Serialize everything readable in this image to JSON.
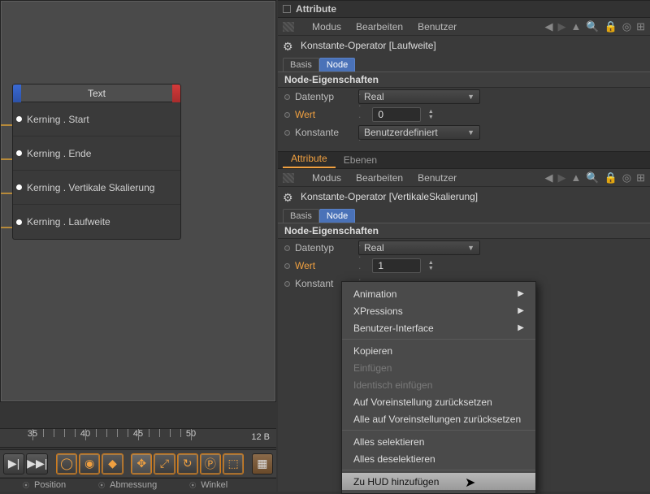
{
  "node": {
    "title": "Text",
    "rows": [
      {
        "label": "Kerning . Start",
        "connected": true
      },
      {
        "label": "Kerning . Ende",
        "connected": true
      },
      {
        "label": "Kerning . Vertikale Skalierung",
        "connected": true
      },
      {
        "label": "Kerning . Laufweite",
        "connected": true
      }
    ]
  },
  "ruler": {
    "ticks": [
      "35",
      "40",
      "45",
      "50"
    ],
    "right": "12 B"
  },
  "status": {
    "pos": "Position",
    "dim": "Abmessung",
    "angle": "Winkel"
  },
  "panel1": {
    "title": "Attribute",
    "menus": [
      "Modus",
      "Bearbeiten",
      "Benutzer"
    ],
    "object": "Konstante-Operator [Laufweite]",
    "tabs": {
      "basis": "Basis",
      "node": "Node"
    },
    "section": "Node-Eigenschaften",
    "props": {
      "datentyp_label": "Datentyp",
      "datentyp_value": "Real",
      "wert_label": "Wert",
      "wert_value": "0",
      "konstante_label": "Konstante",
      "konstante_value": "Benutzerdefiniert"
    }
  },
  "panel2": {
    "tabs": {
      "attribute": "Attribute",
      "ebenen": "Ebenen"
    },
    "menus": [
      "Modus",
      "Bearbeiten",
      "Benutzer"
    ],
    "object": "Konstante-Operator [VertikaleSkalierung]",
    "inner_tabs": {
      "basis": "Basis",
      "node": "Node"
    },
    "section": "Node-Eigenschaften",
    "props": {
      "datentyp_label": "Datentyp",
      "datentyp_value": "Real",
      "wert_label": "Wert",
      "wert_value": "1",
      "konstante_label": "Konstant"
    }
  },
  "ctx": {
    "animation": "Animation",
    "xpressions": "XPressions",
    "ui": "Benutzer-Interface",
    "copy": "Kopieren",
    "paste": "Einfügen",
    "paste_ident": "Identisch einfügen",
    "reset": "Auf Voreinstellung zurücksetzen",
    "reset_all": "Alle auf Voreinstellungen zurücksetzen",
    "select_all": "Alles selektieren",
    "deselect_all": "Alles deselektieren",
    "add_hud": "Zu HUD hinzufügen"
  }
}
